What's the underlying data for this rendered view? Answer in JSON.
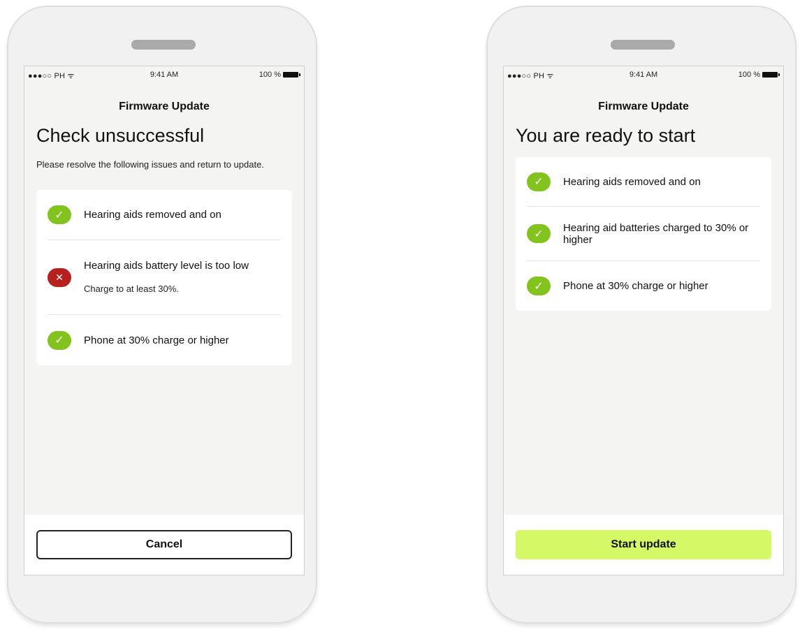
{
  "left_phone": {
    "status": {
      "carrier": "●●●○○ PH ᯤ",
      "time": "9:41 AM",
      "battery": "100 %"
    },
    "title": "Firmware Update",
    "heading": "Check unsuccessful",
    "instructions": "Please resolve the following issues and return to update.",
    "items": [
      {
        "text": "Hearing aids removed and on",
        "status": "ok"
      },
      {
        "text": "Hearing aids battery level is too low",
        "sub": "Charge to at least 30%.",
        "status": "error"
      },
      {
        "text": "Phone at 30% charge or higher",
        "status": "ok"
      }
    ],
    "button": "Cancel"
  },
  "right_phone": {
    "status": {
      "carrier": "●●●○○ PH ᯤ",
      "time": "9:41 AM",
      "battery": "100 %"
    },
    "title": "Firmware Update",
    "heading": "You are ready to start",
    "items": [
      {
        "text": "Hearing aids removed and on",
        "status": "ok"
      },
      {
        "text": "Hearing aid batteries charged to 30% or higher",
        "status": "ok"
      },
      {
        "text": "Phone at 30% charge or higher",
        "status": "ok"
      }
    ],
    "button": "Start update"
  },
  "icons": {
    "check": "check-icon",
    "error": "close-icon"
  },
  "colors": {
    "success": "#83c31d",
    "error": "#b8201f",
    "primary_button": "#d4f866"
  }
}
